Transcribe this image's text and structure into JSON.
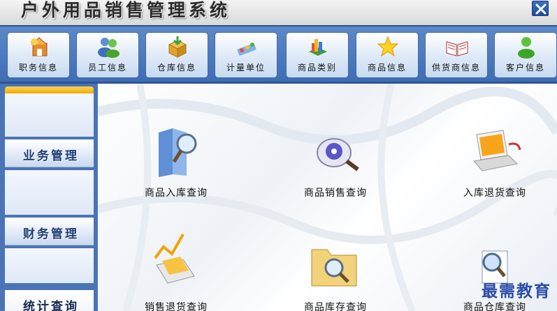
{
  "window": {
    "title": "户外用品销售管理系统",
    "close_icon": "close-icon"
  },
  "toolbar": {
    "items": [
      {
        "label": "职务信息",
        "icon": "briefcase-icon"
      },
      {
        "label": "员工信息",
        "icon": "users-icon"
      },
      {
        "label": "仓库信息",
        "icon": "warehouse-box-icon"
      },
      {
        "label": "计量单位",
        "icon": "measure-icon"
      },
      {
        "label": "商品类别",
        "icon": "category-icon"
      },
      {
        "label": "商品信息",
        "icon": "star-icon"
      },
      {
        "label": "供货商信息",
        "icon": "book-icon"
      },
      {
        "label": "客户信息",
        "icon": "customer-icon"
      }
    ]
  },
  "sidebar": {
    "items": [
      {
        "label": "业务管理",
        "active": false
      },
      {
        "label": "财务管理",
        "active": false
      },
      {
        "label": "统计查询",
        "active": true
      }
    ]
  },
  "main": {
    "queries": [
      {
        "label": "商品入库查询",
        "icon": "book-search-icon"
      },
      {
        "label": "商品销售查询",
        "icon": "disc-search-icon"
      },
      {
        "label": "入库退货查询",
        "icon": "laptop-icon"
      },
      {
        "label": "销售退货查询",
        "icon": "chart-cards-icon"
      },
      {
        "label": "商品库存查询",
        "icon": "folder-search-icon"
      },
      {
        "label": "商品仓库查询",
        "icon": "document-search-icon"
      }
    ]
  },
  "watermark": "最需教育",
  "colors": {
    "toolbar_bg": "#4a76b8",
    "sidebar_bg": "#4a74b5",
    "sidebar_label": "#1f3f78",
    "accent_gold": "#f2a900"
  }
}
